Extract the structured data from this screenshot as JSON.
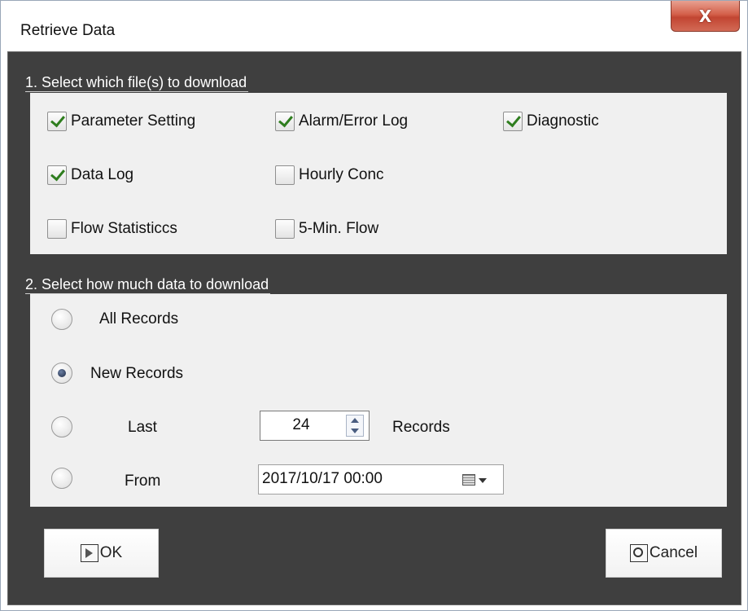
{
  "window": {
    "title": "Retrieve Data",
    "close_glyph": "X"
  },
  "group1": {
    "header": "1. Select which file(s) to download",
    "checkboxes": [
      {
        "label": "Parameter Setting",
        "checked": true
      },
      {
        "label": "Alarm/Error Log",
        "checked": true
      },
      {
        "label": "Diagnostic",
        "checked": true
      },
      {
        "label": "Data Log",
        "checked": true
      },
      {
        "label": "Hourly Conc",
        "checked": false
      },
      {
        "label": "Flow Statisticcs",
        "checked": false
      },
      {
        "label": "5-Min. Flow",
        "checked": false
      }
    ]
  },
  "group2": {
    "header": "2. Select how much data to download",
    "options": [
      {
        "label": "All Records",
        "selected": false
      },
      {
        "label": "New Records",
        "selected": true
      },
      {
        "label": "Last",
        "selected": false
      },
      {
        "label": "From",
        "selected": false
      }
    ],
    "last_value": "24",
    "records_label": "Records",
    "from_value": "2017/10/17 00:00"
  },
  "buttons": {
    "ok_label": "OK",
    "cancel_label": "Cancel"
  },
  "colors": {
    "panel_dark": "#3f3f3f",
    "panel_light": "#f0f0f0",
    "check_mark": "#2e7d1e",
    "close_red": "#c24532"
  },
  "icons": {
    "ok": "ok-arrow-icon",
    "cancel": "cancel-circle-icon",
    "date": "calendar-icon"
  }
}
